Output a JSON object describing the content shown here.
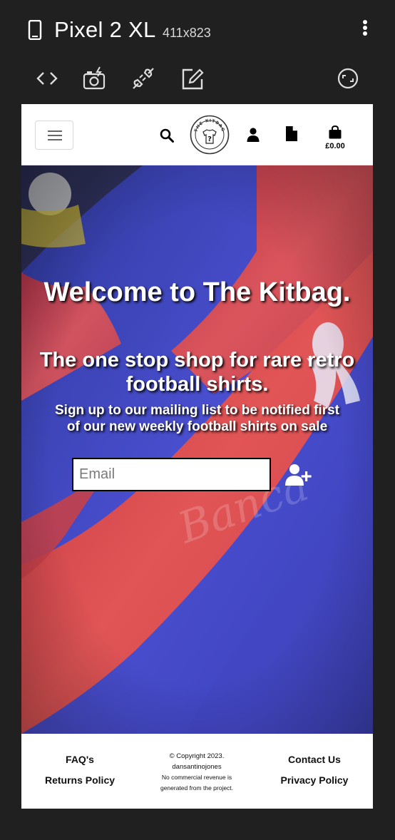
{
  "emulator": {
    "device_name": "Pixel 2 XL",
    "resolution": "411x823",
    "icons": [
      "phone-icon",
      "more-vert-icon",
      "code-icon",
      "screenshot-camera-icon",
      "network-plug-icon",
      "edit-icon",
      "rotate-icon"
    ]
  },
  "header": {
    "menu_icon": "hamburger-icon",
    "search_icon": "search-icon",
    "logo_text": "THE KITBAG",
    "account_icon": "user-icon",
    "document_icon": "document-icon",
    "basket_icon": "shopping-bag-icon",
    "basket_total": "£0.00"
  },
  "hero": {
    "title": "Welcome to The Kitbag.",
    "subtitle": "The one stop shop for rare retro football shirts.",
    "signup_text": "Sign up to our mailing list to be notified first of our new weekly football shirts on sale",
    "email_placeholder": "Email",
    "subscribe_icon": "user-plus-icon",
    "colors": {
      "red": "#d8454a",
      "blue": "#3b3fae"
    }
  },
  "footer": {
    "faq": "FAQ's",
    "returns": "Returns Policy",
    "copyright_line1": "© Copyright 2023.",
    "copyright_line2": "dansantinojones",
    "copyright_line3": "No commercial revenue is",
    "copyright_line4": "generated from the project.",
    "contact": "Contact Us",
    "privacy": "Privacy Policy"
  }
}
